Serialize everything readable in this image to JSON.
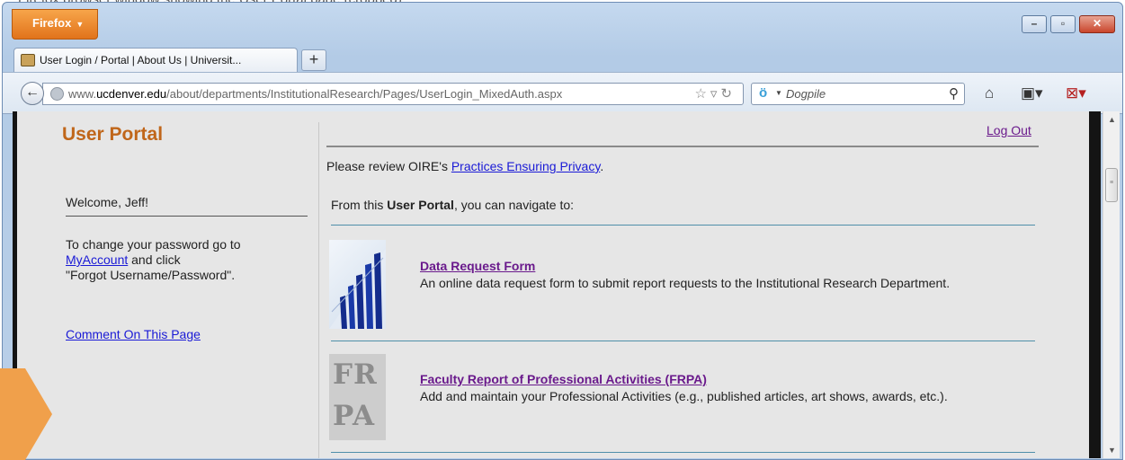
{
  "caption": "Firefox browser window showing the User Portal page (cropped)",
  "browser": {
    "menu_button_label": "Firefox",
    "tab_title": "User Login / Portal | About Us | Universit...",
    "new_tab_label": "+",
    "url_prefix": "www.",
    "url_domain": "ucdenver.edu",
    "url_path": "/about/departments/InstitutionalResearch/Pages/UserLogin_MixedAuth.aspx",
    "search_engine": "Dogpile"
  },
  "sidebar": {
    "title": "User Portal",
    "welcome": "Welcome, Jeff!",
    "pw_line1": "To change your password go to",
    "pw_link": "MyAccount",
    "pw_line2": " and click",
    "pw_line3": "\"Forgot Username/Password\".",
    "comment_link": "Comment On This Page"
  },
  "main": {
    "logout": "Log Out",
    "privacy_prefix": "Please review OIRE's ",
    "privacy_link": "Practices Ensuring Privacy",
    "privacy_suffix": ".",
    "navigate_prefix": "From this ",
    "navigate_bold": "User Portal",
    "navigate_suffix": ", you can navigate to:",
    "items": [
      {
        "title": "Data Request Form",
        "description": "An online data request form to submit report requests to the Institutional Research Department."
      },
      {
        "title": "Faculty Report of Professional Activities (FRPA)",
        "description": "Add and maintain your Professional Activities (e.g., published articles, art shows, awards, etc.).",
        "thumb_text_1": "FR",
        "thumb_text_2": "PA"
      }
    ]
  },
  "colors": {
    "accent_orange": "#c0661a",
    "link_blue": "#1a1ad6",
    "visited_purple": "#6a1a8c",
    "divider_teal": "#4f8fa9"
  }
}
